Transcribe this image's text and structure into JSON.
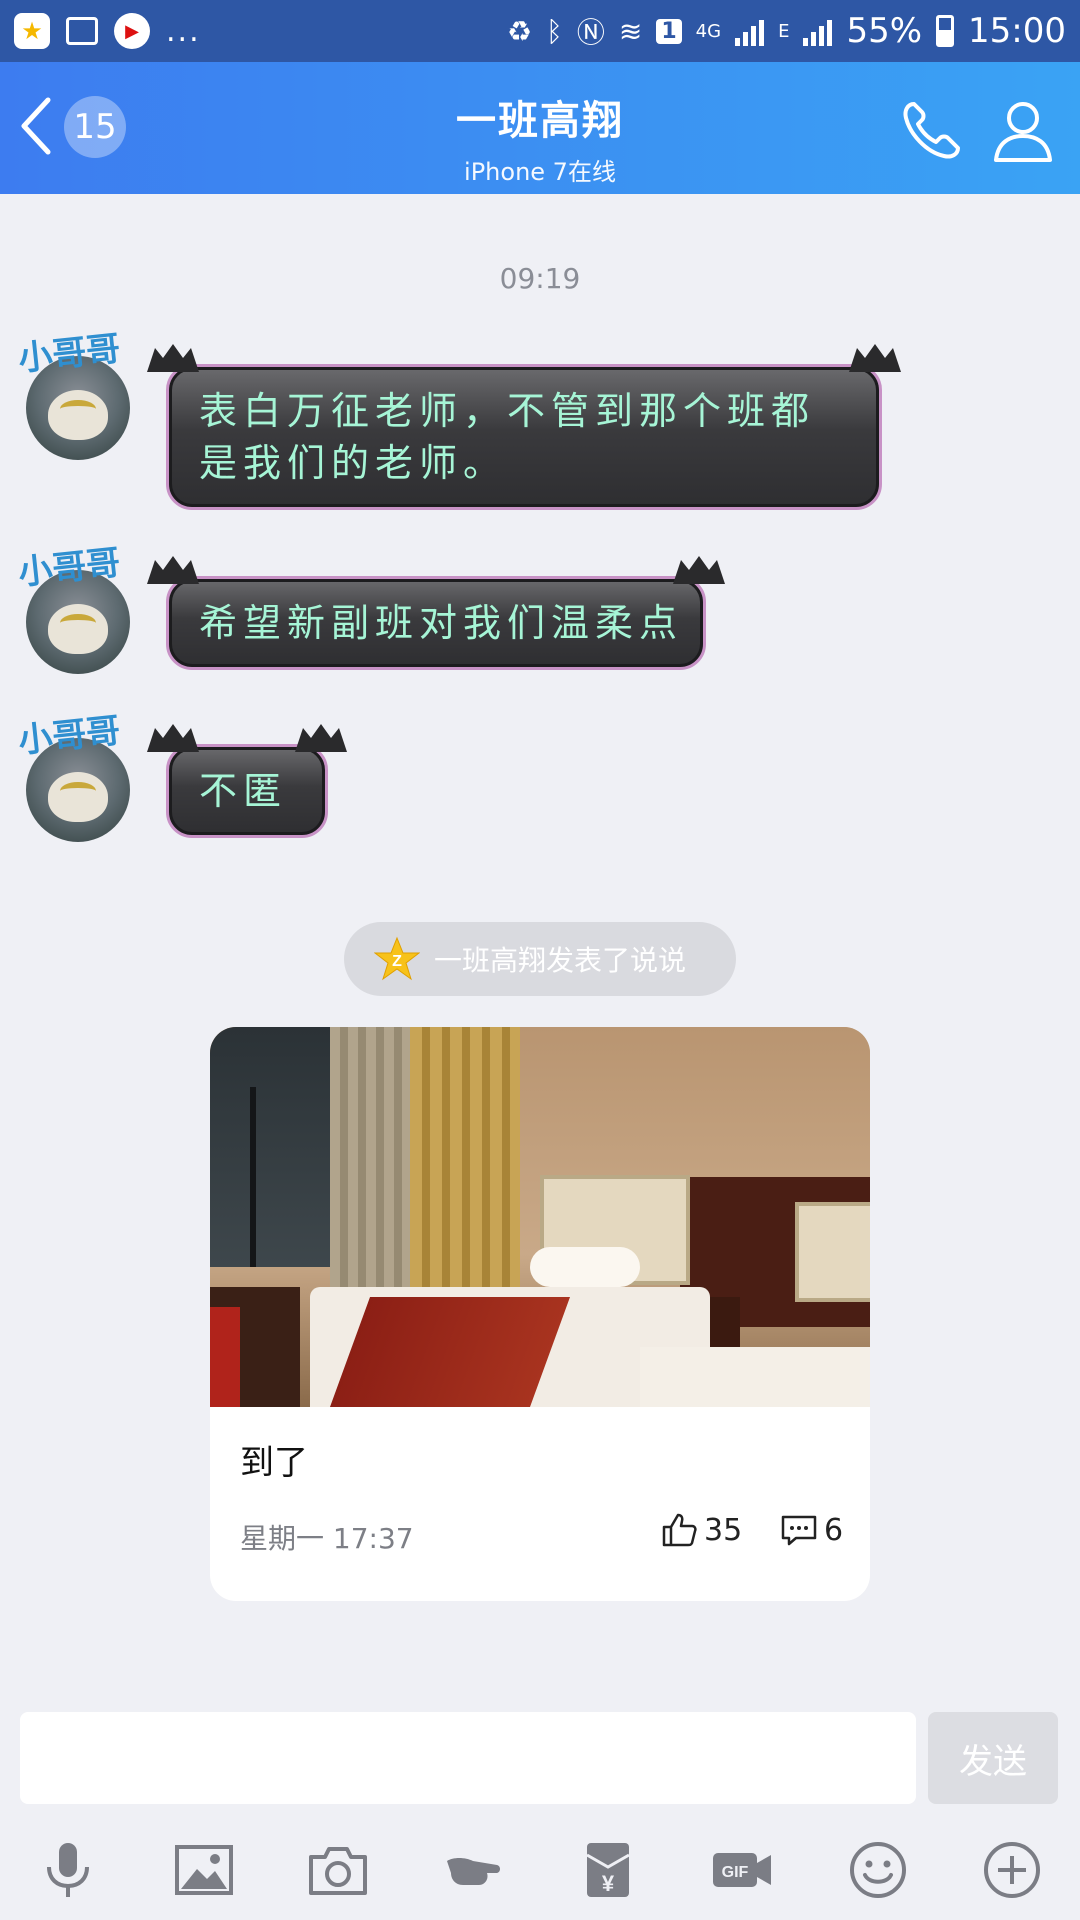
{
  "status_bar": {
    "time": "15:00",
    "battery": "55%",
    "notification_count": "1",
    "network_4g": "4G",
    "network_e": "E",
    "more": "...",
    "icons": [
      "qzone-icon",
      "gallery-icon",
      "video-icon",
      "nfc-battery-icon",
      "bluetooth-icon",
      "nfc-icon",
      "wifi-icon",
      "signal-icon",
      "battery-icon"
    ]
  },
  "header": {
    "unread_count": "15",
    "title": "一班高翔",
    "subtitle": "iPhone 7在线",
    "icons": [
      "back-chevron-icon",
      "phone-icon",
      "profile-icon"
    ]
  },
  "chat": {
    "timestamp": "09:19",
    "sender_tag": "小哥哥",
    "messages": [
      {
        "text": "表白万征老师，不管到那个班都是我们的老师。"
      },
      {
        "text": "希望新副班对我们温柔点"
      },
      {
        "text": "不匿"
      }
    ]
  },
  "feed_notice": {
    "text": "一班高翔发表了说说",
    "icon": "qzone-star-icon"
  },
  "post_card": {
    "caption": "到了",
    "time": "星期一 17:37",
    "likes": "35",
    "comments": "6"
  },
  "input": {
    "value": "",
    "send_label": "发送"
  },
  "toolbar": {
    "items": [
      "microphone-icon",
      "image-icon",
      "camera-icon",
      "poke-icon",
      "red-packet-icon",
      "gif-icon",
      "emoji-icon",
      "plus-icon"
    ]
  },
  "colors": {
    "header_start": "#3d7cf0",
    "header_end": "#3aa3f4",
    "status_bar": "#2e57a5",
    "background": "#eff0f5",
    "bubble_text": "#a6f5d6"
  }
}
